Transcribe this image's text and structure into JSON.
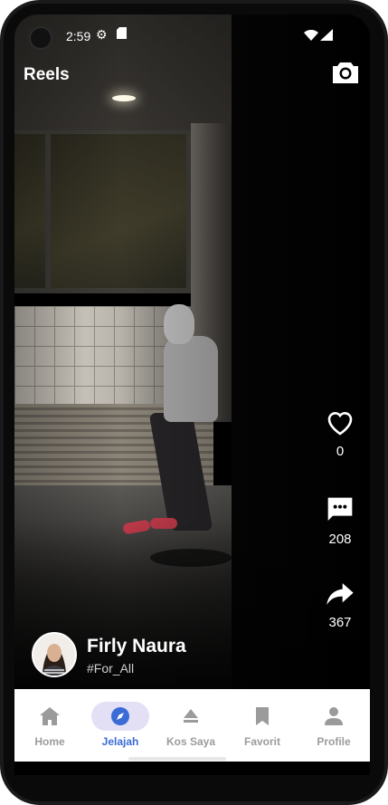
{
  "status_bar": {
    "time": "2:59"
  },
  "header": {
    "title": "Reels"
  },
  "actions": {
    "likes": "0",
    "comments": "208",
    "shares": "367"
  },
  "author": {
    "name": "Firly Naura",
    "tag": "#For_All"
  },
  "nav": {
    "items": [
      {
        "label": "Home",
        "icon": "home-icon"
      },
      {
        "label": "Jelajah",
        "icon": "compass-icon",
        "active": true
      },
      {
        "label": "Kos Saya",
        "icon": "eject-icon"
      },
      {
        "label": "Favorit",
        "icon": "bookmark-icon"
      },
      {
        "label": "Profile",
        "icon": "person-icon"
      }
    ]
  },
  "colors": {
    "accent": "#3a6bd6",
    "active_pill": "#e3e0f6",
    "inactive": "#9b9b9b"
  }
}
